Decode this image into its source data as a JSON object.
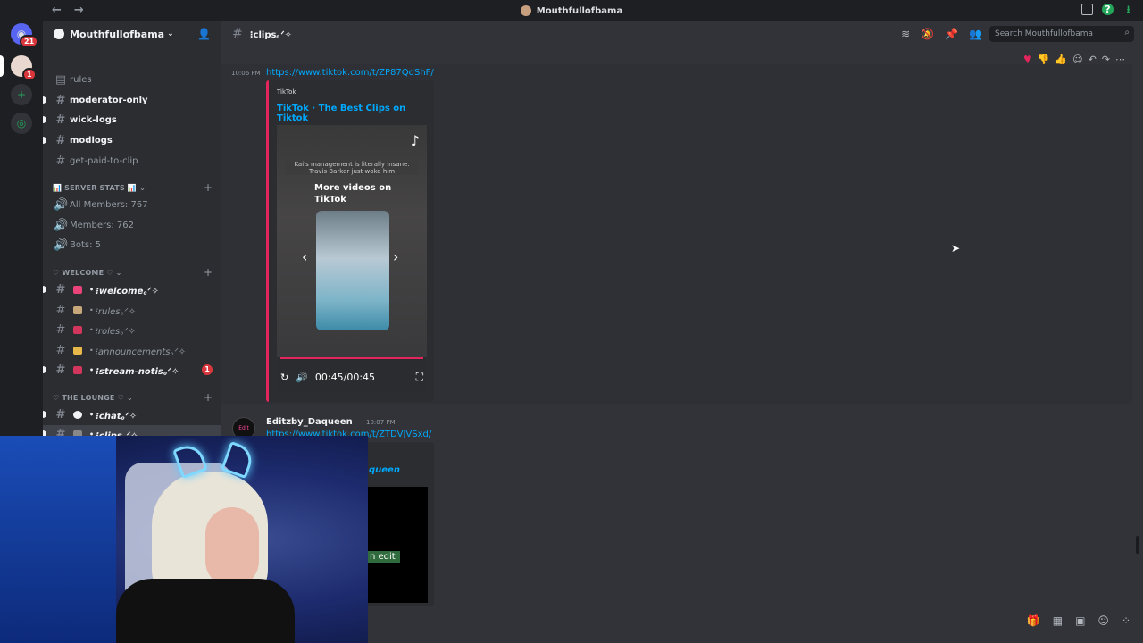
{
  "window": {
    "title": "Mouthfullofbama"
  },
  "servers": {
    "home_badge": "21",
    "dm_badge": "1"
  },
  "sidebar": {
    "server_name": "Mouthfullofbama",
    "channels_top": [
      {
        "label": "rules",
        "unread": false,
        "icon": "rules-icon"
      },
      {
        "label": "moderator-only",
        "unread": true,
        "icon": "hash-icon"
      },
      {
        "label": "wick-logs",
        "unread": true,
        "icon": "hash-icon"
      },
      {
        "label": "modlogs",
        "unread": true,
        "icon": "hash-icon"
      },
      {
        "label": "get-paid-to-clip",
        "unread": false,
        "icon": "hash-icon"
      }
    ],
    "category_stats": "📊 SERVER STATS 📊",
    "stats": [
      {
        "label": "All Members: 767"
      },
      {
        "label": "Members: 762"
      },
      {
        "label": "Bots: 5"
      }
    ],
    "category_welcome": "♡ WELCOME ♡",
    "welcome_channels": [
      {
        "emoji_color": "#e8447a",
        "label": "⁝welcome｡ᐟ✧",
        "unread": true
      },
      {
        "emoji_color": "#c8a87a",
        "label": "⁝rules｡ᐟ✧",
        "unread": false
      },
      {
        "emoji_color": "#d2365c",
        "label": "⁝roles｡ᐟ✧",
        "unread": false
      },
      {
        "emoji_color": "#e8b84a",
        "label": "⁝announcements｡ᐟ✧",
        "unread": false
      },
      {
        "emoji_color": "#d2365c",
        "label": "⁝stream-notis｡ᐟ✧",
        "unread": true,
        "mention": "1"
      }
    ],
    "category_lounge": "♡ THE LOUNGE ♡",
    "lounge_channels": [
      {
        "emoji_color": "#f2f3f5",
        "label": "⁝chat｡ᐟ✧",
        "unread": true
      },
      {
        "emoji_color": "#888888",
        "label": "⁝clips｡ᐟ✧",
        "unread": true
      }
    ]
  },
  "header": {
    "channel_name": "⁝clips｡ᐟ✧",
    "search_placeholder": "Search Mouthfullofbama"
  },
  "messages": {
    "first": {
      "time": "10:06 PM",
      "link": "https://www.tiktok.com/t/ZP87QdShF/",
      "embed": {
        "provider": "TikTok",
        "title": "TikTok · The Best Clips on Tiktok",
        "caption": "Kai's management is literally insane. Travis Barker just woke him",
        "more_videos": "More videos on TikTok",
        "timecode": "00:45/00:45",
        "progress": 1.0
      }
    },
    "second": {
      "username": "Editzby_Daqueen",
      "time": "10:07 PM",
      "link": "https://www.tiktok.com/t/ZTDVJVSxd/",
      "embed_title": "queen",
      "tag": "n edit"
    }
  }
}
